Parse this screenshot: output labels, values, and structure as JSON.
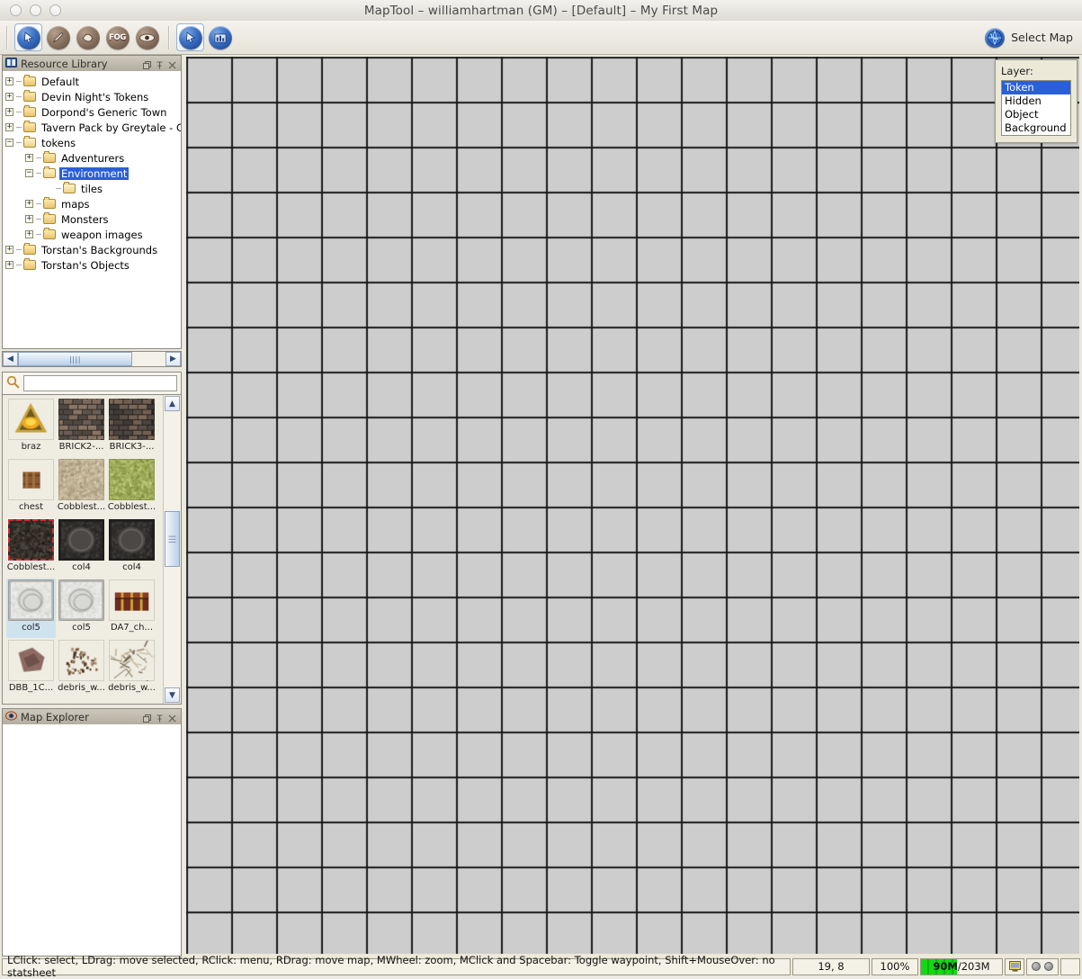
{
  "window": {
    "title": "MapTool – williamhartman (GM) – [Default] – My First Map"
  },
  "toolbar": {
    "tools": [
      {
        "name": "pointer-tool",
        "icon": "pointer-icon",
        "selected": true,
        "style": "blue"
      },
      {
        "name": "draw-tool",
        "icon": "paintbrush-icon",
        "selected": false,
        "style": "brown"
      },
      {
        "name": "template-tool",
        "icon": "shape-icon",
        "selected": false,
        "style": "brown"
      },
      {
        "name": "fog-tool",
        "icon": "fog-icon",
        "selected": false,
        "style": "brown",
        "text": "FOG"
      },
      {
        "name": "vision-tool",
        "icon": "eye-icon",
        "selected": false,
        "style": "brown"
      }
    ],
    "tools2": [
      {
        "name": "pointer-tool-2",
        "icon": "pointer-icon",
        "selected": true,
        "style": "blue"
      },
      {
        "name": "chart-tool",
        "icon": "bar-chart-icon",
        "selected": false,
        "style": "blue"
      }
    ],
    "select_map_label": "Select Map"
  },
  "resource_library": {
    "title": "Resource Library",
    "tree": [
      {
        "label": "Default",
        "depth": 0,
        "expander": "+",
        "open": false,
        "selected": false
      },
      {
        "label": "Devin Night's Tokens",
        "depth": 0,
        "expander": "+",
        "open": false,
        "selected": false
      },
      {
        "label": "Dorpond's Generic Town",
        "depth": 0,
        "expander": "+",
        "open": false,
        "selected": false
      },
      {
        "label": "Tavern Pack by Greytale - Gri",
        "depth": 0,
        "expander": "+",
        "open": false,
        "selected": false
      },
      {
        "label": "tokens",
        "depth": 0,
        "expander": "−",
        "open": true,
        "selected": false
      },
      {
        "label": "Adventurers",
        "depth": 1,
        "expander": "+",
        "open": false,
        "selected": false
      },
      {
        "label": "Environment",
        "depth": 1,
        "expander": "−",
        "open": true,
        "selected": true
      },
      {
        "label": "tiles",
        "depth": 2,
        "expander": "",
        "open": true,
        "selected": false
      },
      {
        "label": "maps",
        "depth": 1,
        "expander": "+",
        "open": false,
        "selected": false
      },
      {
        "label": "Monsters",
        "depth": 1,
        "expander": "+",
        "open": false,
        "selected": false
      },
      {
        "label": "weapon images",
        "depth": 1,
        "expander": "+",
        "open": false,
        "selected": false
      },
      {
        "label": "Torstan's Backgrounds",
        "depth": 0,
        "expander": "+",
        "open": false,
        "selected": false
      },
      {
        "label": "Torstan's Objects",
        "depth": 0,
        "expander": "+",
        "open": false,
        "selected": false
      }
    ]
  },
  "search": {
    "value": "",
    "placeholder": ""
  },
  "assets": [
    {
      "caption": "braz",
      "selection": "none",
      "art": "brazier"
    },
    {
      "caption": "BRICK2-...",
      "selection": "none",
      "art": "brick-dark"
    },
    {
      "caption": "BRICK3-...",
      "selection": "none",
      "art": "brick-dark2"
    },
    {
      "caption": "chest",
      "selection": "none",
      "art": "barrel"
    },
    {
      "caption": "Cobblest...",
      "selection": "none",
      "art": "cobble-tan"
    },
    {
      "caption": "Cobblest...",
      "selection": "none",
      "art": "cobble-green"
    },
    {
      "caption": "Cobblest...",
      "selection": "red",
      "art": "cobble-black"
    },
    {
      "caption": "col4",
      "selection": "none",
      "art": "col-dark"
    },
    {
      "caption": "col4",
      "selection": "none",
      "art": "col-dark"
    },
    {
      "caption": "col5",
      "selection": "blue",
      "art": "col-light"
    },
    {
      "caption": "col5",
      "selection": "none",
      "art": "col-light"
    },
    {
      "caption": "DA7_ch...",
      "selection": "none",
      "art": "chest-wood"
    },
    {
      "caption": "DBB_1C...",
      "selection": "none",
      "art": "rock"
    },
    {
      "caption": "debris_w...",
      "selection": "none",
      "art": "debris1"
    },
    {
      "caption": "debris_w...",
      "selection": "none",
      "art": "debris2"
    }
  ],
  "map_explorer": {
    "title": "Map Explorer"
  },
  "layer_panel": {
    "label": "Layer:",
    "options": [
      {
        "label": "Token",
        "selected": true
      },
      {
        "label": "Hidden",
        "selected": false
      },
      {
        "label": "Object",
        "selected": false
      },
      {
        "label": "Background",
        "selected": false
      }
    ]
  },
  "status_bar": {
    "hint": "LClick: select, LDrag: move selected, RClick: menu, RDrag: move map, MWheel: zoom, MClick and Spacebar: Toggle waypoint, Shift+MouseOver: no statsheet",
    "coordinates": "19, 8",
    "zoom": "100%",
    "memory_used": "90M",
    "memory_total": "/203M",
    "memory_percent": 44
  },
  "colors": {
    "accent": "#2a5fd8",
    "grid_cell": "#cdcdcd",
    "grid_line": "#1a1a1a",
    "memory_bar": "#13d913",
    "panel_bg": "#ece9d8"
  }
}
